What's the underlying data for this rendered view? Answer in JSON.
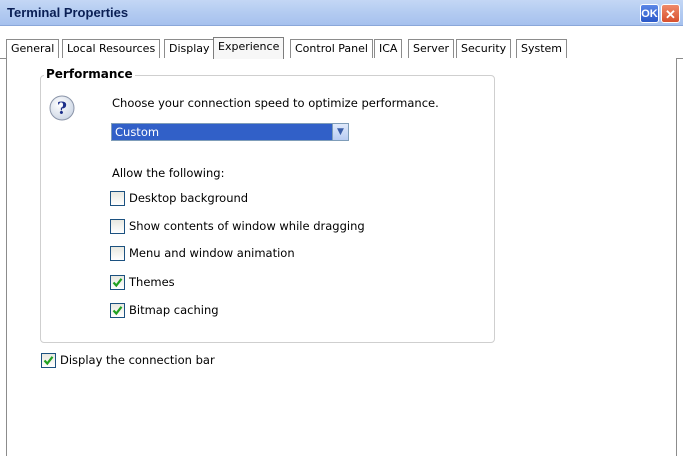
{
  "window": {
    "title": "Terminal Properties",
    "ok_label": "OK",
    "close_label": "✕"
  },
  "tabs": [
    {
      "label": "General",
      "active": false
    },
    {
      "label": "Local Resources",
      "active": false
    },
    {
      "label": "Display",
      "active": false
    },
    {
      "label": "Experience",
      "active": true
    },
    {
      "label": "Control Panel",
      "active": false
    },
    {
      "label": "ICA",
      "active": false
    },
    {
      "label": "Server",
      "active": false
    },
    {
      "label": "Security",
      "active": false
    },
    {
      "label": "System",
      "active": false
    }
  ],
  "performance": {
    "group_title": "Performance",
    "icon": "help-question-icon",
    "prompt": "Choose your connection speed to optimize performance.",
    "speed_select": {
      "value": "Custom",
      "dropdown_icon": "chevron-down-icon"
    },
    "allow_label": "Allow the following:",
    "options": [
      {
        "label": "Desktop background",
        "checked": false
      },
      {
        "label": "Show contents of window while dragging",
        "checked": false
      },
      {
        "label": "Menu and window animation",
        "checked": false
      },
      {
        "label": "Themes",
        "checked": true
      },
      {
        "label": "Bitmap caching",
        "checked": true
      }
    ]
  },
  "connection_bar": {
    "label": "Display the connection bar",
    "checked": true
  },
  "colors": {
    "titlebar": "#b3cbf1",
    "selected_combo": "#3160c8",
    "check": "#21a121"
  }
}
